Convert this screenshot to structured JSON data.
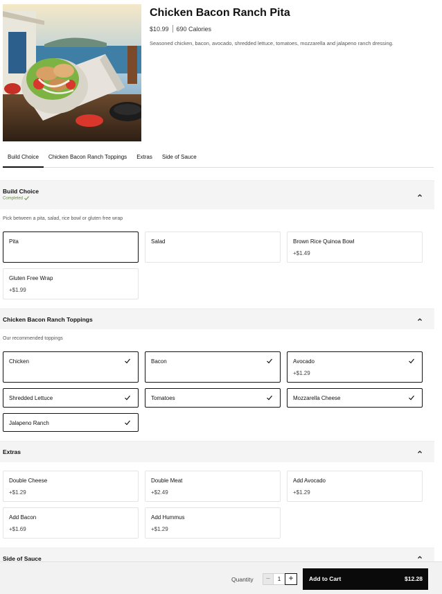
{
  "product": {
    "title": "Chicken Bacon Ranch Pita",
    "price": "$10.99",
    "calories": "690 Calories",
    "description": "Seasoned chicken, bacon, avocado, shredded lettuce, tomatoes, mozzarella and jalapeno ranch dressing.",
    "image_subject": "chicken-bacon-ranch-pita-photo"
  },
  "tabs": [
    "Build Choice",
    "Chicken Bacon Ranch Toppings",
    "Extras",
    "Side of Sauce"
  ],
  "build": {
    "title": "Build Choice",
    "status": "Completed",
    "subtext": "Pick between a pita, salad, rice bowl or gluten free wrap",
    "options": [
      {
        "name": "Pita",
        "price": "",
        "selected": true
      },
      {
        "name": "Salad",
        "price": "",
        "selected": false
      },
      {
        "name": "Brown Rice Quinoa Bowl",
        "price": "+$1.49",
        "selected": false
      },
      {
        "name": "Gluten Free Wrap",
        "price": "+$1.99",
        "selected": false
      }
    ]
  },
  "toppings": {
    "title": "Chicken Bacon Ranch Toppings",
    "subtext": "Our recommended toppings",
    "options": [
      {
        "name": "Chicken",
        "price": "",
        "selected": true
      },
      {
        "name": "Bacon",
        "price": "",
        "selected": true
      },
      {
        "name": "Avocado",
        "price": "+$1.29",
        "selected": true
      },
      {
        "name": "Shredded Lettuce",
        "price": "",
        "selected": true
      },
      {
        "name": "Tomatoes",
        "price": "",
        "selected": true
      },
      {
        "name": "Mozzarella Cheese",
        "price": "",
        "selected": true
      },
      {
        "name": "Jalapeno Ranch",
        "price": "",
        "selected": true
      }
    ]
  },
  "extras": {
    "title": "Extras",
    "options": [
      {
        "name": "Double Cheese",
        "price": "+$1.29"
      },
      {
        "name": "Double Meat",
        "price": "+$2.49"
      },
      {
        "name": "Add Avocado",
        "price": "+$1.29"
      },
      {
        "name": "Add Bacon",
        "price": "+$1.69"
      },
      {
        "name": "Add Hummus",
        "price": "+$1.29"
      }
    ]
  },
  "sauce": {
    "title": "Side of Sauce"
  },
  "footer": {
    "quantity_label": "Quantity",
    "quantity": "1",
    "minus": "−",
    "plus": "+",
    "add_to_cart": "Add to Cart",
    "total": "$12.28"
  },
  "colors": {
    "accent": "#0a0a0a",
    "completed": "#6a8a4a",
    "section_bg": "#f4f4f4"
  }
}
